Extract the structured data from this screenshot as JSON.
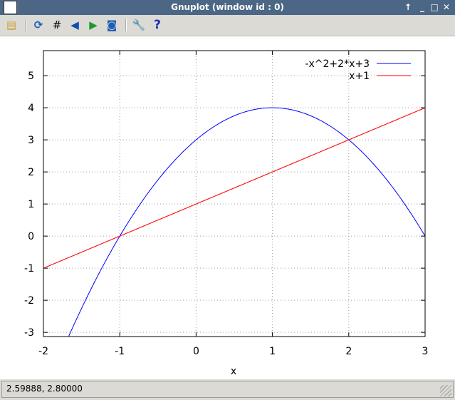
{
  "window": {
    "title": "Gnuplot (window id : 0)"
  },
  "toolbar": {
    "items": [
      "copy-to-clipboard",
      "replot",
      "toggle-grid",
      "previous-zoom",
      "next-zoom",
      "autoscale",
      "settings",
      "help"
    ],
    "help_label": "?"
  },
  "status": {
    "coords": "2.59888,  2.80000"
  },
  "chart_data": {
    "type": "line",
    "title": "",
    "xlabel": "x",
    "ylabel": "",
    "xlim": [
      -2,
      3
    ],
    "ylim": [
      -3.13,
      5.78
    ],
    "xticks": [
      -2,
      -1,
      0,
      1,
      2,
      3
    ],
    "yticks": [
      -3,
      -2,
      -1,
      0,
      1,
      2,
      3,
      4,
      5
    ],
    "grid": true,
    "legend": "top-right",
    "series": [
      {
        "name": "-x^2+2*x+3",
        "expr": "-x^2+2*x+3",
        "color": "#0000ff"
      },
      {
        "name": "x+1",
        "expr": "x+1",
        "color": "#ff0000"
      }
    ]
  }
}
